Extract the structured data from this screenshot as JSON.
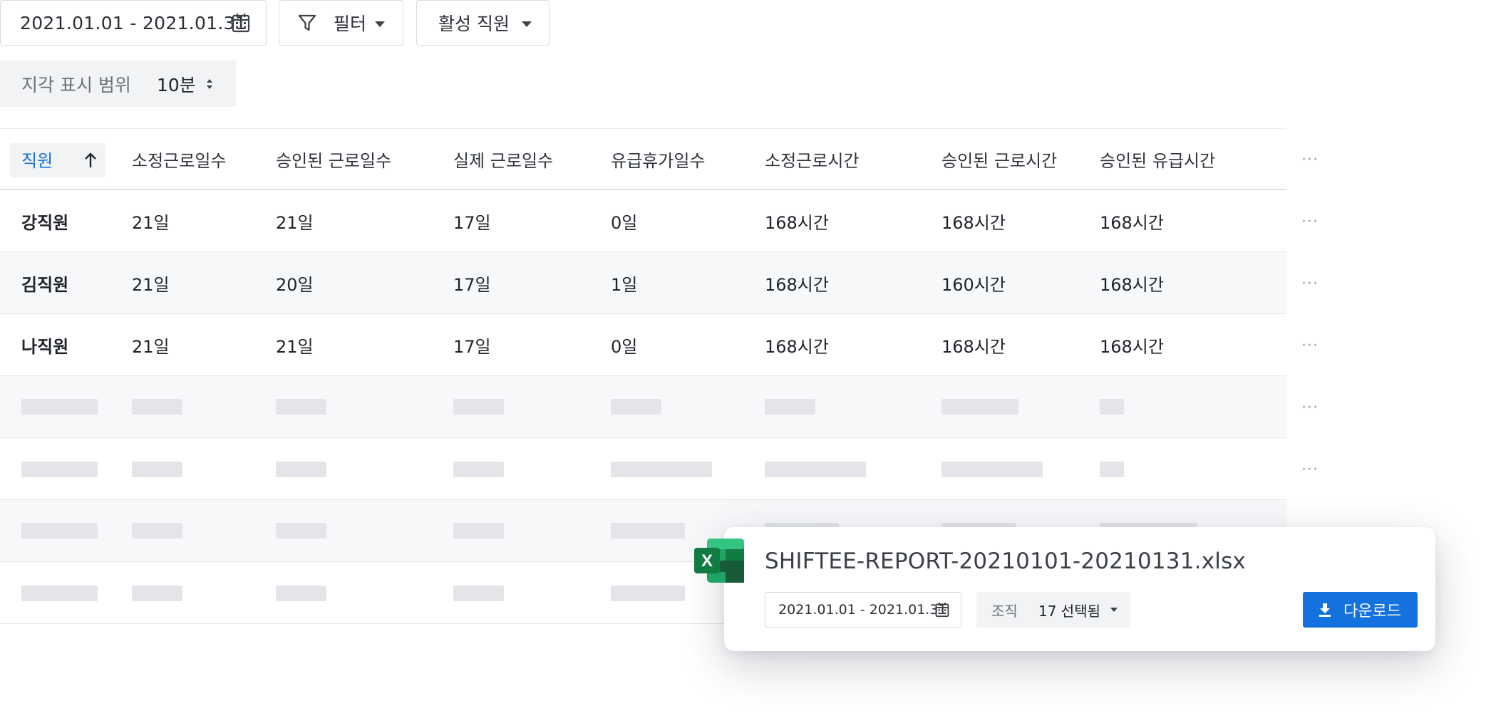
{
  "toolbar": {
    "date_range": "2021.01.01 - 2021.01.31",
    "filter_label": "필터",
    "employee_status_label": "활성 직원"
  },
  "late_range": {
    "label": "지각 표시 범위",
    "value": "10분"
  },
  "table": {
    "columns": [
      "직원",
      "소정근로일수",
      "승인된 근로일수",
      "실제 근로일수",
      "유급휴가일수",
      "소정근로시간",
      "승인된 근로시간",
      "승인된 유급시간"
    ],
    "sorted_column": "직원",
    "sort_direction": "ascending",
    "rows": [
      [
        "강직원",
        "21일",
        "21일",
        "17일",
        "0일",
        "168시간",
        "168시간",
        "168시간"
      ],
      [
        "김직원",
        "21일",
        "20일",
        "17일",
        "1일",
        "168시간",
        "160시간",
        "168시간"
      ],
      [
        "나직원",
        "21일",
        "21일",
        "17일",
        "0일",
        "168시간",
        "168시간",
        "168시간"
      ]
    ],
    "more_symbol": "···"
  },
  "export_popup": {
    "file_name": "SHIFTEE-REPORT-20210101-20210131.xlsx",
    "date_range": "2021.01.01 - 2021.01.31",
    "org_label": "조직",
    "org_value": "17 선택됨",
    "download_label": "다운로드",
    "excel_letter": "X"
  },
  "colors": {
    "accent": "#1472de",
    "excel_green": "#1d7044",
    "sort_active": "#1472de"
  }
}
